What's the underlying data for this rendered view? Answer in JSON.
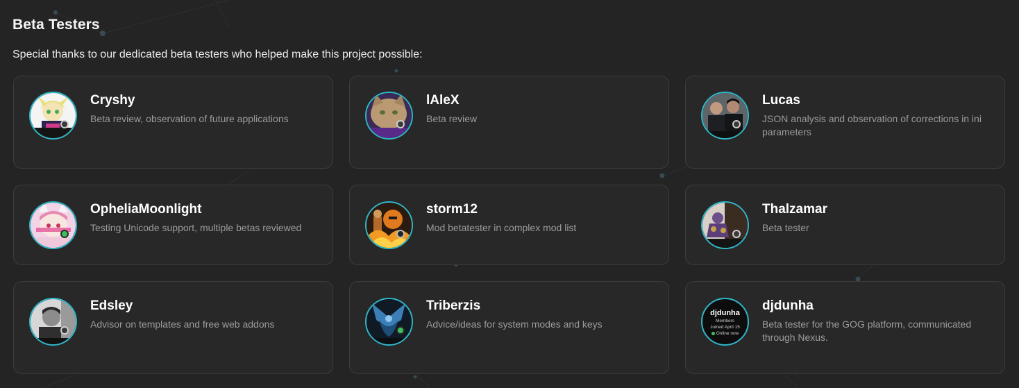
{
  "section": {
    "title": "Beta Testers",
    "intro": "Special thanks to our dedicated beta testers who helped make this project possible:"
  },
  "testers": [
    {
      "name": "Cryshy",
      "role": "Beta review, observation of future applications",
      "avatar_icon": "anime-character-avatar",
      "status": "offline"
    },
    {
      "name": "lAleX",
      "role": "Beta review",
      "avatar_icon": "cat-avatar",
      "status": "offline"
    },
    {
      "name": "Lucas",
      "role": "JSON analysis and observation of corrections in ini parameters",
      "avatar_icon": "two-people-photo-avatar",
      "status": "offline"
    },
    {
      "name": "OpheliaMoonlight",
      "role": "Testing Unicode support, multiple betas reviewed",
      "avatar_icon": "pink-anime-avatar",
      "status": "online"
    },
    {
      "name": "storm12",
      "role": "Mod betatester in complex mod list",
      "avatar_icon": "fire-scene-avatar",
      "status": "away"
    },
    {
      "name": "Thalzamar",
      "role": "Beta tester",
      "avatar_icon": "armored-character-avatar",
      "status": "offline"
    },
    {
      "name": "Edsley",
      "role": "Advisor on templates and free web addons",
      "avatar_icon": "bw-portrait-avatar",
      "status": "offline"
    },
    {
      "name": "Triberzis",
      "role": "Advice/ideas for system modes and keys",
      "avatar_icon": "blue-emblem-avatar",
      "status": "online"
    },
    {
      "name": "djdunha",
      "role": "Beta tester for the GOG platform, communicated through Nexus.",
      "avatar_icon": "profile-badge-avatar",
      "status": "none",
      "badge": {
        "name": "djdunha",
        "group": "Members",
        "joined": "Joined April 15",
        "online": "Online now"
      }
    }
  ],
  "colors": {
    "background": "#232423",
    "card_border": "#3b3d3c",
    "avatar_ring": "#2fb6c8",
    "online": "#3bc15a",
    "muted_text": "#9b9c9b"
  }
}
